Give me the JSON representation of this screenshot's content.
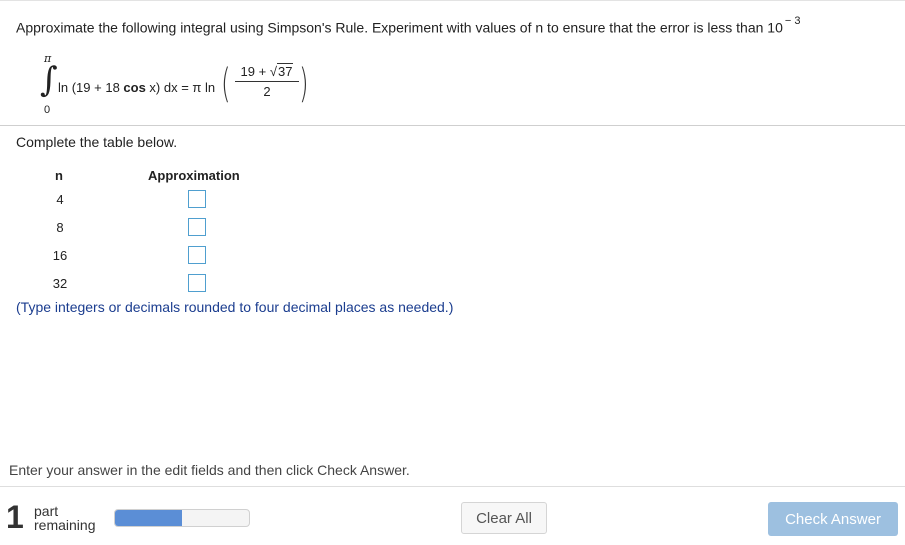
{
  "question": {
    "text": "Approximate the following integral using Simpson's Rule. Experiment with values of n to ensure that the error is less than 10",
    "exponent": "− 3"
  },
  "integral": {
    "upper_limit": "π",
    "lower_limit": "0",
    "integrand_prefix": "ln (19 + 18 ",
    "integrand_cos": "cos",
    "integrand_suffix": " x) dx = π ln",
    "frac_num_prefix": "19 + √",
    "frac_num_root": "37",
    "frac_den": "2"
  },
  "table": {
    "prompt": "Complete the table below.",
    "header_n": "n",
    "header_approx": "Approximation",
    "rows": [
      {
        "n": "4",
        "value": ""
      },
      {
        "n": "8",
        "value": ""
      },
      {
        "n": "16",
        "value": ""
      },
      {
        "n": "32",
        "value": ""
      }
    ],
    "hint": "(Type integers or decimals rounded to four decimal places as needed.)"
  },
  "footer": {
    "instruction": "Enter your answer in the edit fields and then click Check Answer.",
    "parts_remaining_count": "1",
    "parts_remaining_word1": "part",
    "parts_remaining_word2": "remaining",
    "progress_fraction": 0.5,
    "progress_color": "#5b8ed6",
    "clear_label": "Clear All",
    "check_label": "Check Answer"
  }
}
